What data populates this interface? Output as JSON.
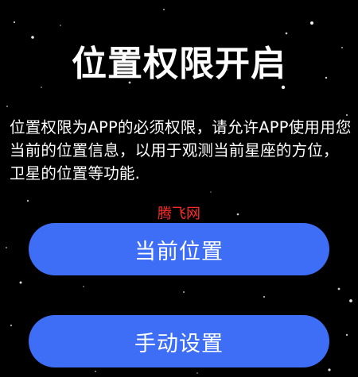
{
  "page": {
    "title": "位置权限开启",
    "description": "位置权限为APP的必须权限，请允许APP使用用您当前的位置信息，以用于观测当前星座的方位，卫星的位置等功能.",
    "watermark": "腾飞网"
  },
  "buttons": {
    "current_location": "当前位置",
    "manual_setup": "手动设置"
  },
  "colors": {
    "background": "#000000",
    "button": "#3d6ef5",
    "text": "#ffffff",
    "watermark": "#ff2a2a"
  }
}
